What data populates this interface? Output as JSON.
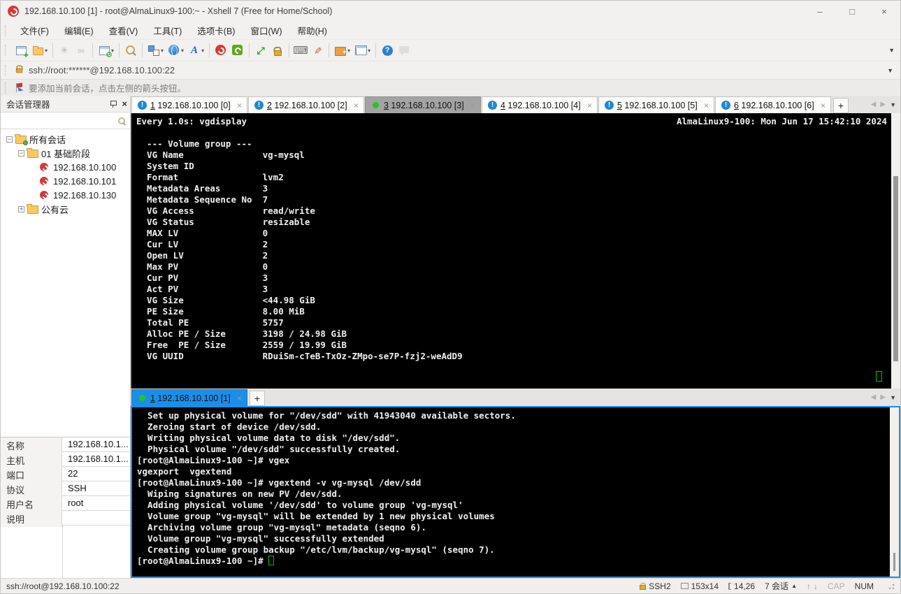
{
  "window": {
    "title": "192.168.10.100 [1] - root@AlmaLinux9-100:~ - Xshell 7 (Free for Home/School)",
    "minimize": "–",
    "maximize": "□",
    "close": "×"
  },
  "menu": {
    "items": [
      "文件(F)",
      "编辑(E)",
      "查看(V)",
      "工具(T)",
      "选项卡(B)",
      "窗口(W)",
      "帮助(H)"
    ]
  },
  "toolbar": {
    "items": [
      {
        "name": "new-session",
        "dropdown": false
      },
      {
        "name": "open-folder",
        "dropdown": true,
        "shape": "folder"
      },
      {
        "sep": true
      },
      {
        "name": "disconnect",
        "dropdown": false,
        "disabled": true
      },
      {
        "name": "reconnect",
        "dropdown": false,
        "disabled": true
      },
      {
        "sep": true
      },
      {
        "name": "session-properties",
        "dropdown": true
      },
      {
        "sep": true
      },
      {
        "name": "find",
        "dropdown": false
      },
      {
        "sep": true
      },
      {
        "name": "transfer-layout",
        "dropdown": true
      },
      {
        "name": "encoding-globe",
        "dropdown": true
      },
      {
        "name": "font",
        "dropdown": true
      },
      {
        "sep": true
      },
      {
        "name": "xshell",
        "dropdown": false
      },
      {
        "name": "xftp",
        "dropdown": false
      },
      {
        "sep": true
      },
      {
        "name": "fullscreen",
        "dropdown": false
      },
      {
        "name": "lock-screen",
        "dropdown": false,
        "shape": "lock"
      },
      {
        "sep": true
      },
      {
        "name": "virtual-keyboard",
        "dropdown": false
      },
      {
        "name": "highlight-pen",
        "dropdown": false
      },
      {
        "sep": true
      },
      {
        "name": "new-terminal",
        "dropdown": true
      },
      {
        "name": "split-layout",
        "dropdown": true
      },
      {
        "sep": true
      },
      {
        "name": "help",
        "dropdown": false
      },
      {
        "name": "feedback",
        "dropdown": false,
        "disabled": true
      }
    ]
  },
  "address_bar": {
    "value": "ssh://root:******@192.168.10.100:22"
  },
  "notice_bar": {
    "text": "要添加当前会话，点击左侧的箭头按钮。"
  },
  "sidebar": {
    "title": "会话管理器",
    "tree": [
      {
        "label": "所有会话",
        "level": 0,
        "expander": "-",
        "icon": "all-sessions-folder"
      },
      {
        "label": "01 基础阶段",
        "level": 1,
        "expander": "-",
        "icon": "folder"
      },
      {
        "label": "192.168.10.100",
        "level": 2,
        "expander": "",
        "icon": "session"
      },
      {
        "label": "192.168.10.101",
        "level": 2,
        "expander": "",
        "icon": "session"
      },
      {
        "label": "192.168.10.130",
        "level": 2,
        "expander": "",
        "icon": "session"
      },
      {
        "label": "公有云",
        "level": 1,
        "expander": "+",
        "icon": "folder"
      }
    ],
    "properties": [
      {
        "label": "名称",
        "value": "192.168.10.1..."
      },
      {
        "label": "主机",
        "value": "192.168.10.1..."
      },
      {
        "label": "端口",
        "value": "22"
      },
      {
        "label": "协议",
        "value": "SSH"
      },
      {
        "label": "用户名",
        "value": "root"
      },
      {
        "label": "说明",
        "value": ""
      }
    ]
  },
  "top_tabs": [
    {
      "num": "1",
      "label": "192.168.10.100 [0]",
      "status": "alert",
      "active": false
    },
    {
      "num": "2",
      "label": "192.168.10.100 [2]",
      "status": "alert",
      "active": false
    },
    {
      "num": "3",
      "label": "192.168.10.100 [3]",
      "status": "connected",
      "active": true
    },
    {
      "num": "4",
      "label": "192.168.10.100 [4]",
      "status": "alert",
      "active": false
    },
    {
      "num": "5",
      "label": "192.168.10.100 [5]",
      "status": "alert",
      "active": false
    },
    {
      "num": "6",
      "label": "192.168.10.100 [6]",
      "status": "alert",
      "active": false
    }
  ],
  "bottom_tabs": [
    {
      "num": "1",
      "label": "192.168.10.100 [1]",
      "status": "connected",
      "active": true
    }
  ],
  "terminal_top": {
    "header_left": "Every 1.0s: vgdisplay",
    "header_right": "AlmaLinux9-100: Mon Jun 17 15:42:10 2024",
    "lines": [
      "",
      "  --- Volume group ---",
      "  VG Name               vg-mysql",
      "  System ID",
      "  Format                lvm2",
      "  Metadata Areas        3",
      "  Metadata Sequence No  7",
      "  VG Access             read/write",
      "  VG Status             resizable",
      "  MAX LV                0",
      "  Cur LV                2",
      "  Open LV               2",
      "  Max PV                0",
      "  Cur PV                3",
      "  Act PV                3",
      "  VG Size               <44.98 GiB",
      "  PE Size               8.00 MiB",
      "  Total PE              5757",
      "  Alloc PE / Size       3198 / 24.98 GiB",
      "  Free  PE / Size       2559 / 19.99 GiB",
      "  VG UUID               RDuiSm-cTeB-TxOz-ZMpo-se7P-fzj2-weAdD9"
    ]
  },
  "terminal_bottom": {
    "lines": [
      "  Set up physical volume for \"/dev/sdd\" with 41943040 available sectors.",
      "  Zeroing start of device /dev/sdd.",
      "  Writing physical volume data to disk \"/dev/sdd\".",
      "  Physical volume \"/dev/sdd\" successfully created.",
      "[root@AlmaLinux9-100 ~]# vgex",
      "vgexport  vgextend",
      "[root@AlmaLinux9-100 ~]# vgextend -v vg-mysql /dev/sdd",
      "  Wiping signatures on new PV /dev/sdd.",
      "  Adding physical volume '/dev/sdd' to volume group 'vg-mysql'",
      "  Volume group \"vg-mysql\" will be extended by 1 new physical volumes",
      "  Archiving volume group \"vg-mysql\" metadata (seqno 6).",
      "  Volume group \"vg-mysql\" successfully extended",
      "  Creating volume group backup \"/etc/lvm/backup/vg-mysql\" (seqno 7)."
    ],
    "prompt": "[root@AlmaLinux9-100 ~]# "
  },
  "status_bar": {
    "left": "ssh://root@192.168.10.100:22",
    "encryption": "SSH2",
    "terminal_size": "153x14",
    "cursor_pos": "14,26",
    "sessions": "7 会话",
    "cap": "CAP",
    "num": "NUM"
  }
}
